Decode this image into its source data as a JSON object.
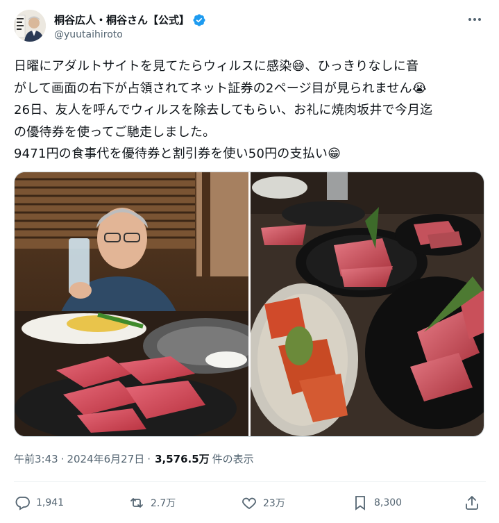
{
  "author": {
    "name": "桐谷広人・桐谷さん【公式】",
    "handle": "@yuutaihiroto",
    "verified": true,
    "avatar_icon": "profile-photo"
  },
  "tweet": {
    "lines": [
      "日曜にアダルトサイトを見てたらウィルスに感染😅、ひっきりなしに音",
      "がして画面の右下が占領されてネット証券の2ページ目が見られません😭",
      "26日、友人を呼んでウィルスを除去してもらい、お礼に焼肉坂井で今月迄",
      "の優待券を使ってご馳走しました。",
      "9471円の食事代を優待券と割引券を使い50円の支払い😁"
    ]
  },
  "meta": {
    "time": "午前3:43",
    "separator": "·",
    "date": "2024年6月27日",
    "separator2": "·",
    "views": "3,576.5万",
    "views_label": "件の表示"
  },
  "actions": {
    "reply_count": "1,941",
    "retweet_count": "2.7万",
    "like_count": "23万",
    "bookmark_count": "8,300"
  },
  "colors": {
    "text": "#0f1419",
    "secondary": "#536471",
    "verified_blue": "#1d9bf0",
    "divider": "#eff3f4"
  }
}
